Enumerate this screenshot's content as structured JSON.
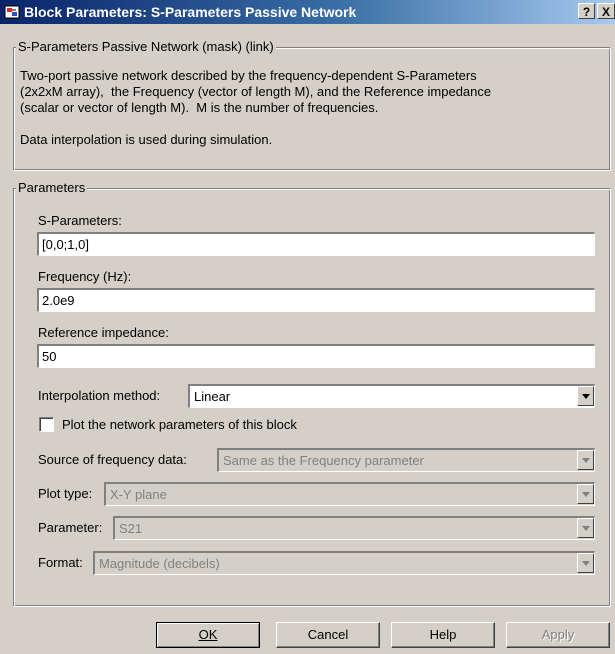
{
  "window": {
    "title": "Block Parameters: S-Parameters Passive Network",
    "help_glyph": "?",
    "close_glyph": "X"
  },
  "description": {
    "legend": "S-Parameters Passive Network (mask) (link)",
    "text": "Two-port passive network described by the frequency-dependent S-Parameters\n(2x2xM array),  the Frequency (vector of length M), and the Reference impedance\n(scalar or vector of length M).  M is the number of frequencies.\n\nData interpolation is used during simulation."
  },
  "parameters": {
    "legend": "Parameters",
    "s_params_label": "S-Parameters:",
    "s_params_value": "[0,0;1,0]",
    "frequency_label": "Frequency (Hz):",
    "frequency_value": "2.0e9",
    "ref_impedance_label": "Reference impedance:",
    "ref_impedance_value": "50",
    "interp_label": "Interpolation method:",
    "interp_value": "Linear",
    "plot_checkbox_label": "Plot the network parameters of this block",
    "plot_checked": false,
    "source_label": "Source of frequency data:",
    "source_value": "Same as the Frequency parameter",
    "plot_type_label": "Plot type:",
    "plot_type_value": "X-Y plane",
    "parameter_label": "Parameter:",
    "parameter_value": "S21",
    "format_label": "Format:",
    "format_value": "Magnitude (decibels)"
  },
  "buttons": {
    "ok": "OK",
    "cancel": "Cancel",
    "help": "Help",
    "apply": "Apply"
  }
}
